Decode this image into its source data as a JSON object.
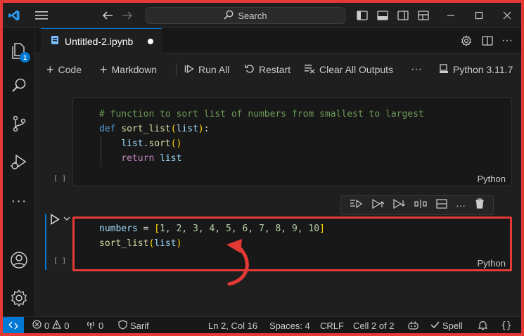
{
  "titlebar": {
    "search_label": "Search"
  },
  "activitybar": {
    "explorer_badge": "1"
  },
  "tab": {
    "filename": "Untitled-2.ipynb"
  },
  "nb_toolbar": {
    "code": "Code",
    "markdown": "Markdown",
    "run_all": "Run All",
    "restart": "Restart",
    "clear_outputs": "Clear All Outputs",
    "more": "···",
    "kernel": "Python 3.11.7"
  },
  "cell1": {
    "lines": [
      "# function to sort list of numbers from smallest to largest",
      "def sort_list(list):",
      "    list.sort()",
      "    return list"
    ],
    "exec_count": "[ ]",
    "language": "Python"
  },
  "cell2": {
    "lines": [
      "numbers = [1, 2, 3, 4, 5, 6, 7, 8, 9, 10]",
      "sort_list(list)"
    ],
    "exec_count": "[ ]",
    "language": "Python"
  },
  "statusbar": {
    "errors": "0",
    "warnings": "0",
    "ports": "0",
    "profile": "Sarif",
    "position": "Ln 2, Col 16",
    "spaces": "Spaces: 4",
    "eol": "CRLF",
    "cell": "Cell 2 of 2",
    "spell": "Spell"
  },
  "colors": {
    "accent": "#0078d4",
    "highlight": "#e53935"
  }
}
